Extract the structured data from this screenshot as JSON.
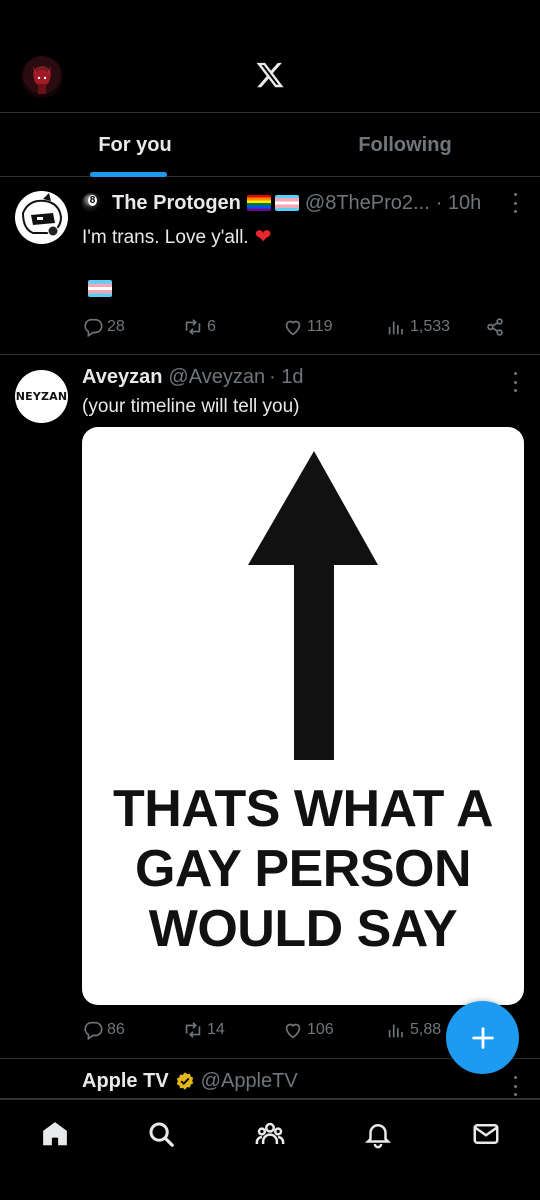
{
  "colors": {
    "accent": "#1d9bf0",
    "background": "#000000",
    "muted": "#71767b",
    "text": "#e7e9ea",
    "heart": "#e8262f"
  },
  "header": {
    "logo_icon": "x-logo-icon",
    "avatar_icon": "profile-avatar"
  },
  "tabs": [
    {
      "label": "For you",
      "active": true
    },
    {
      "label": "Following",
      "active": false
    }
  ],
  "tweets": [
    {
      "name": "The Protogen",
      "handle": "@8ThePro2...",
      "time": "· 10h",
      "text": "I'm trans. Love y'all.",
      "stats": {
        "replies": "28",
        "reposts": "6",
        "likes": "119",
        "views": "1,533"
      }
    },
    {
      "name": "Aveyzan",
      "handle": "@Aveyzan",
      "time": "· 1d",
      "avatar_text": "NEYZAN",
      "text": "(your timeline will tell you)",
      "media_lines": [
        "THATS WHAT A",
        "GAY PERSON",
        "WOULD SAY"
      ],
      "stats": {
        "replies": "86",
        "reposts": "14",
        "likes": "106",
        "views": "5,88"
      }
    },
    {
      "name": "Apple TV",
      "handle": "@AppleTV"
    }
  ],
  "fab": {
    "icon": "plus-icon"
  },
  "bottom_nav": [
    "home-icon",
    "search-icon",
    "communities-icon",
    "notifications-icon",
    "messages-icon"
  ]
}
